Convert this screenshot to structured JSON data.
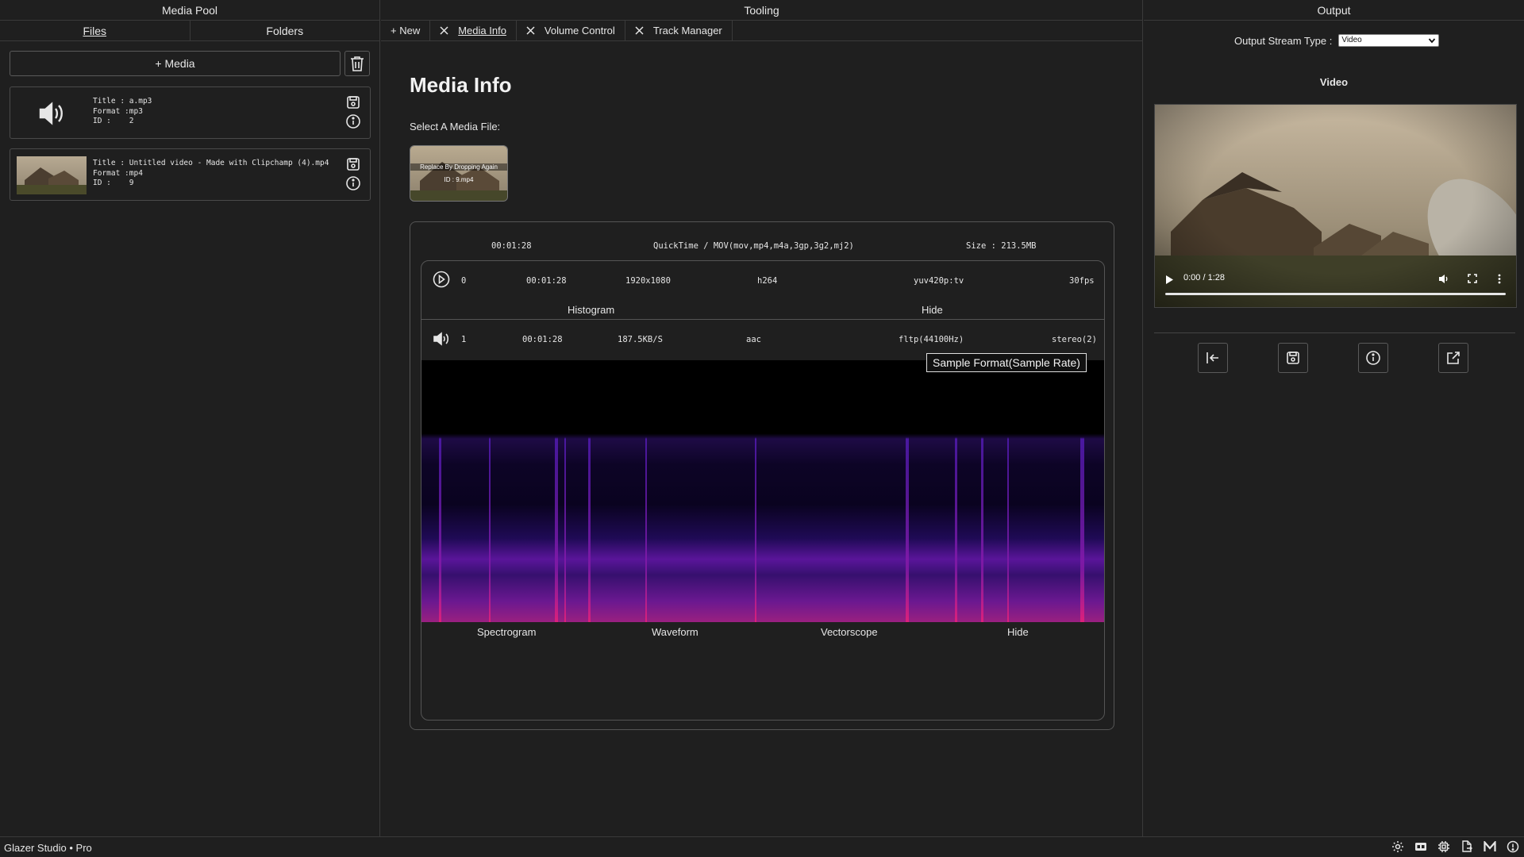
{
  "panels": {
    "left_title": "Media Pool",
    "middle_title": "Tooling",
    "right_title": "Output"
  },
  "media_pool": {
    "tabs": [
      {
        "label": "Files",
        "active": true
      },
      {
        "label": "Folders",
        "active": false
      }
    ],
    "add_media_label": "+ Media",
    "items": [
      {
        "title_label": "Title :",
        "title": "a.mp3",
        "format_label": "Format :",
        "format": "mp3",
        "id_label": "ID :",
        "id": "2",
        "kind": "audio"
      },
      {
        "title_label": "Title :",
        "title": "Untitled video - Made with Clipchamp (4).mp4",
        "format_label": "Format :",
        "format": "mp4",
        "id_label": "ID :",
        "id": "9",
        "kind": "video"
      }
    ]
  },
  "tooling": {
    "new_tab_label": "+ New",
    "tabs": [
      {
        "label": "Media Info",
        "active": true
      },
      {
        "label": "Volume Control",
        "active": false
      },
      {
        "label": "Track Manager",
        "active": false
      }
    ],
    "heading": "Media Info",
    "select_label": "Select A Media File:",
    "drop_text": "Replace By Dropping Again",
    "drop_id": "ID : 9.mp4",
    "file": {
      "duration": "00:01:28",
      "container": "QuickTime / MOV(mov,mp4,m4a,3gp,3g2,mj2)",
      "size": "Size : 213.5MB"
    },
    "video_stream": {
      "index": "0",
      "duration": "00:01:28",
      "resolution": "1920x1080",
      "codec": "h264",
      "pix_fmt": "yuv420p:tv",
      "fps": "30fps"
    },
    "video_views": [
      "Histogram",
      "Hide"
    ],
    "audio_stream": {
      "index": "1",
      "duration": "00:01:28",
      "bitrate": "187.5KB/S",
      "codec": "aac",
      "sample_format": "fltp(44100Hz)",
      "channels": "stereo(2)"
    },
    "tooltip": "Sample Format(Sample Rate)",
    "audio_views": [
      "Spectrogram",
      "Waveform",
      "Vectorscope",
      "Hide"
    ]
  },
  "output": {
    "stream_type_label": "Output Stream Type :",
    "stream_type_value": "Video",
    "preview_title": "Video",
    "video_time": "0:00 / 1:28"
  },
  "status": {
    "app_name": "Glazer Studio • Pro"
  },
  "colors": {
    "background": "#1f1f1f",
    "border": "#3a3a3a",
    "spectrogram_low": "#1a0b4a",
    "spectrogram_high": "#e0207a"
  }
}
